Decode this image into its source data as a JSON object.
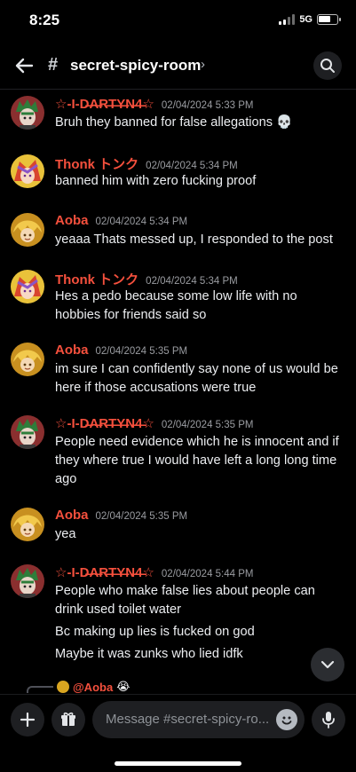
{
  "status": {
    "time": "8:25",
    "network": "5G",
    "battery_level": 0.7
  },
  "header": {
    "channel_hash": "#",
    "channel_name": "secret-spicy-room",
    "chevron": "›"
  },
  "messages": [
    {
      "user": "☆-I-D̶A̶R̶T̶Y̶N̶4̶☆",
      "avatar": "green-hair-avatar",
      "timestamp": "02/04/2024 5:33 PM",
      "lines": [
        "Bruh they banned for false allegations 💀"
      ]
    },
    {
      "user": "Thonk トンク",
      "avatar": "pink-anime-avatar",
      "timestamp": "02/04/2024 5:34 PM",
      "lines": [
        "banned him with zero fucking proof"
      ]
    },
    {
      "user": "Aoba",
      "avatar": "gold-anime-avatar",
      "timestamp": "02/04/2024 5:34 PM",
      "lines": [
        "yeaaa Thats messed up, I responded to the post"
      ]
    },
    {
      "user": "Thonk トンク",
      "avatar": "pink-anime-avatar",
      "timestamp": "02/04/2024 5:34 PM",
      "lines": [
        "Hes a pedo because some low life with no",
        "hobbies for friends said so"
      ]
    },
    {
      "user": "Aoba",
      "avatar": "gold-anime-avatar",
      "timestamp": "02/04/2024 5:35 PM",
      "lines": [
        "im sure I can confidently say none of us would be",
        "here if those accusations were true"
      ]
    },
    {
      "user": "☆-I-D̶A̶R̶T̶Y̶N̶4̶☆",
      "avatar": "green-hair-avatar",
      "timestamp": "02/04/2024 5:35 PM",
      "lines": [
        "People need evidence which he is innocent and if",
        "they where true I would have left a long long time",
        "ago"
      ]
    },
    {
      "user": "Aoba",
      "avatar": "gold-anime-avatar",
      "timestamp": "02/04/2024 5:35 PM",
      "lines": [
        "yea"
      ]
    },
    {
      "user": "☆-I-D̶A̶R̶T̶Y̶N̶4̶☆",
      "avatar": "green-hair-avatar",
      "timestamp": "02/04/2024 5:44 PM",
      "lines": [
        "People who make false lies about people can",
        "drink used toilet water",
        "Bc making up lies is fucked on god",
        "Maybe it was zunks who lied idfk"
      ]
    }
  ],
  "reply_preview": {
    "mention": "@Aoba",
    "emoji": "😭"
  },
  "composer": {
    "placeholder": "Message #secret-spicy-ro..."
  },
  "colors": {
    "username": "#f5503d",
    "background": "#000000",
    "input_bg": "#1e1f22"
  }
}
